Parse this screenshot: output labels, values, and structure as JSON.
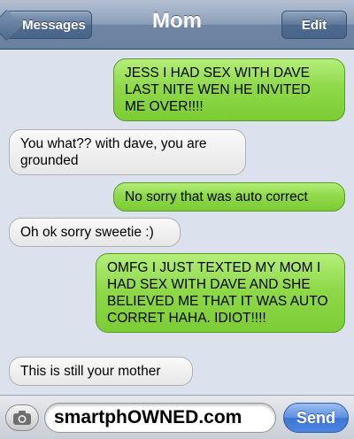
{
  "navbar": {
    "back_label": "Messages",
    "title": "Mom",
    "edit_label": "Edit"
  },
  "messages": [
    {
      "sender": "me",
      "text": "JESS I HAD SEX WITH DAVE LAST NITE WEN HE INVITED ME OVER!!!!"
    },
    {
      "sender": "mom",
      "text": "You what?? with dave, you are grounded"
    },
    {
      "sender": "me",
      "text": "No sorry that was auto correct"
    },
    {
      "sender": "mom",
      "text": "Oh ok sorry sweetie :)"
    },
    {
      "sender": "me",
      "text": "OMFG I JUST TEXTED MY MOM I HAD SEX WITH DAVE AND SHE BELIEVED ME THAT IT WAS AUTO CORRET HAHA. IDIOT!!!!"
    },
    {
      "sender": "mom",
      "text": "This is still your mother"
    }
  ],
  "input": {
    "value": "smartphOWNED.com",
    "send_label": "Send",
    "camera_icon": "camera-icon"
  },
  "colors": {
    "sent_bubble": "#8fd94a",
    "received_bubble": "#ececec",
    "send_button": "#4c84de"
  }
}
